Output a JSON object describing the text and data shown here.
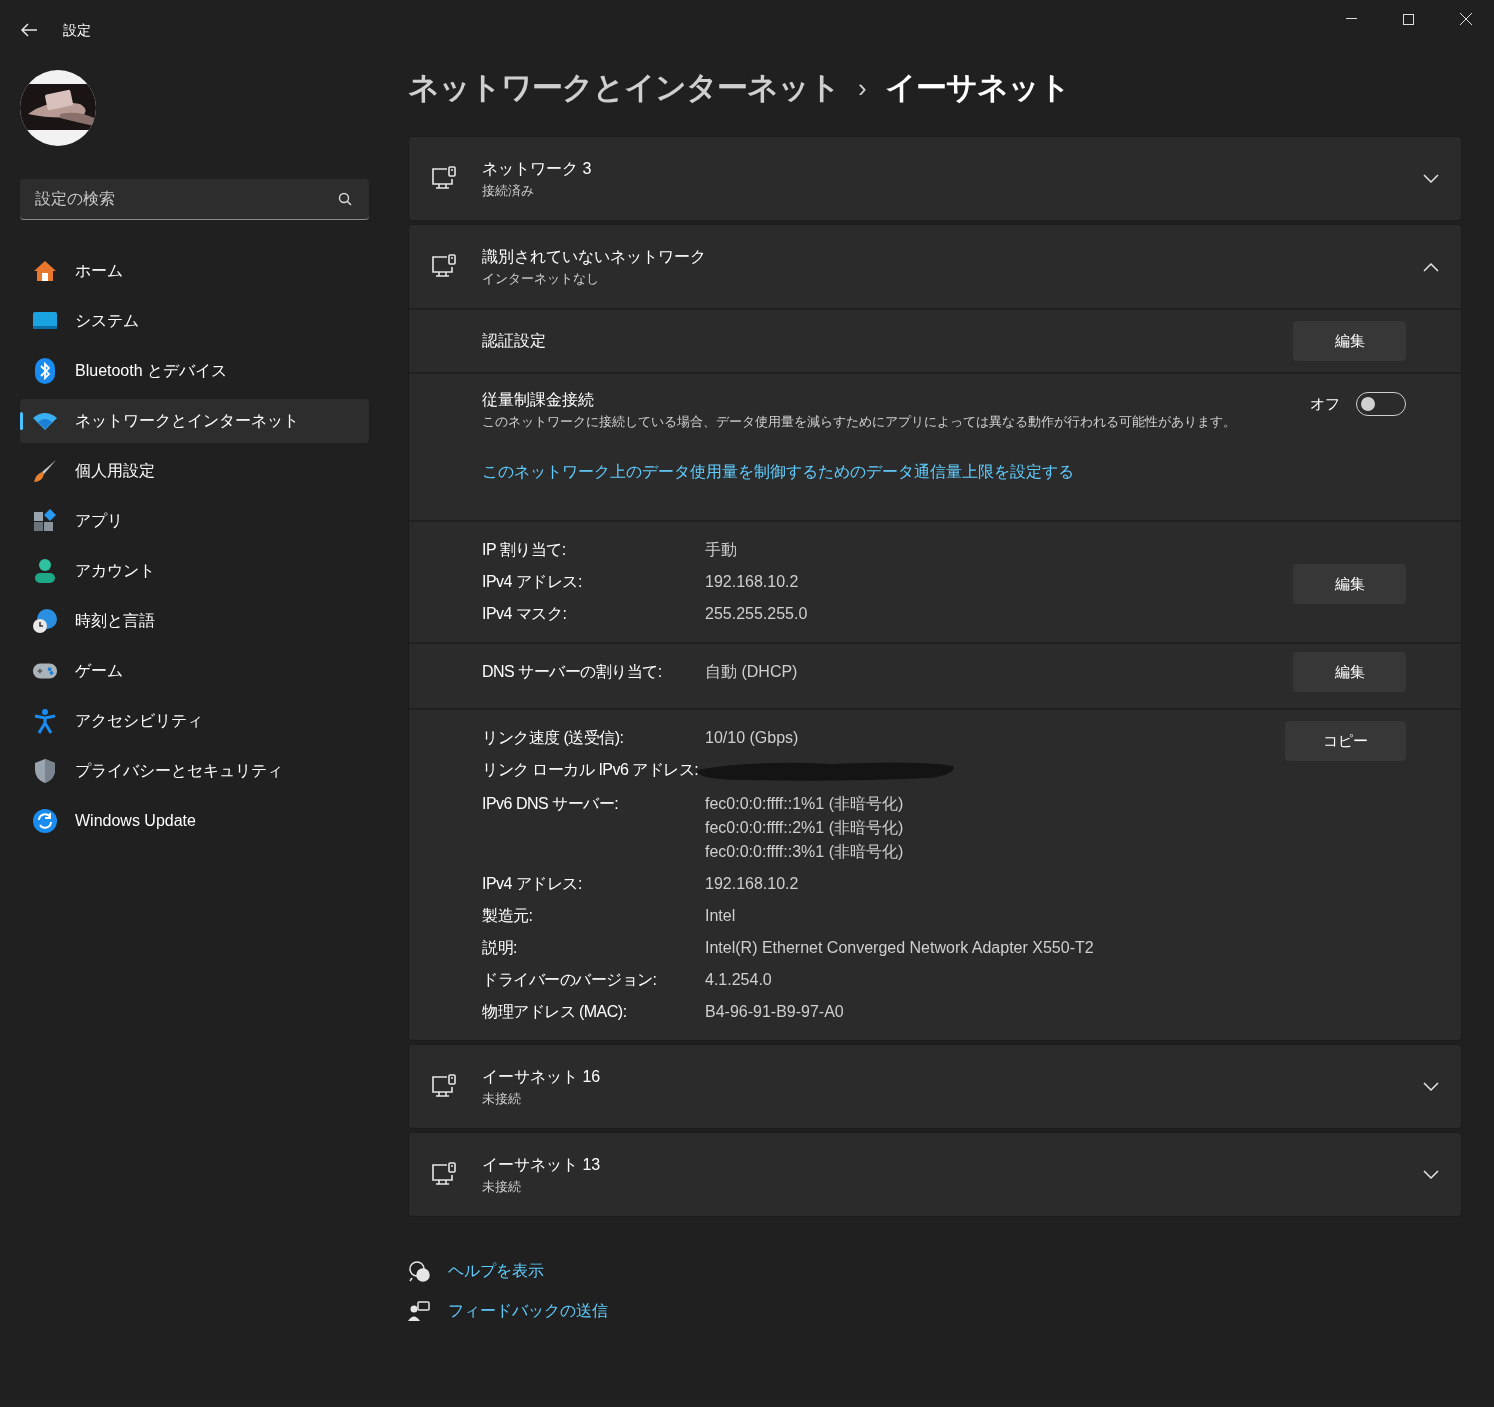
{
  "window": {
    "title": "設定"
  },
  "sidebar": {
    "search": {
      "placeholder": "設定の検索"
    },
    "items": [
      {
        "label": "ホーム",
        "selected": false
      },
      {
        "label": "システム",
        "selected": false
      },
      {
        "label": "Bluetooth とデバイス",
        "selected": false
      },
      {
        "label": "ネットワークとインターネット",
        "selected": true
      },
      {
        "label": "個人用設定",
        "selected": false
      },
      {
        "label": "アプリ",
        "selected": false
      },
      {
        "label": "アカウント",
        "selected": false
      },
      {
        "label": "時刻と言語",
        "selected": false
      },
      {
        "label": "ゲーム",
        "selected": false
      },
      {
        "label": "アクセシビリティ",
        "selected": false
      },
      {
        "label": "プライバシーとセキュリティ",
        "selected": false
      },
      {
        "label": "Windows Update",
        "selected": false
      }
    ]
  },
  "breadcrumb": {
    "parent": "ネットワークとインターネット",
    "separator": "›",
    "current": "イーサネット"
  },
  "networks": [
    {
      "name": "ネットワーク 3",
      "status": "接続済み",
      "expanded": false
    },
    {
      "name": "識別されていないネットワーク",
      "status": "インターネットなし",
      "expanded": true,
      "sections": [
        {
          "kind": "setting",
          "title": "認証設定",
          "button": "編集"
        },
        {
          "kind": "toggle",
          "title": "従量制課金接続",
          "description": "このネットワークに接続している場合、データ使用量を減らすためにアプリによっては異なる動作が行われる可能性があります。",
          "toggle_label": "オフ",
          "on": false,
          "link": "このネットワーク上のデータ使用量を制御するためのデータ通信量上限を設定する"
        },
        {
          "kind": "info",
          "button": "編集",
          "rows": [
            {
              "label": "IP 割り当て:",
              "values": [
                "手動"
              ],
              "redacted": false
            },
            {
              "label": "IPv4 アドレス:",
              "values": [
                "192.168.10.2"
              ],
              "redacted": false
            },
            {
              "label": "IPv4 マスク:",
              "values": [
                "255.255.255.0"
              ],
              "redacted": false
            }
          ]
        },
        {
          "kind": "info",
          "button": "編集",
          "rows": [
            {
              "label": "DNS サーバーの割り当て:",
              "values": [
                "自動 (DHCP)"
              ],
              "redacted": false
            }
          ]
        },
        {
          "kind": "info",
          "button": "コピー",
          "rows": [
            {
              "label": "リンク速度 (送受信):",
              "values": [
                "10/10 (Gbps)"
              ],
              "redacted": false
            },
            {
              "label": "リンク ローカル IPv6 アドレス:",
              "values": [],
              "redacted": true
            },
            {
              "label": "IPv6 DNS サーバー:",
              "values": [
                "fec0:0:0:ffff::1%1 (非暗号化)",
                "fec0:0:0:ffff::2%1 (非暗号化)",
                "fec0:0:0:ffff::3%1 (非暗号化)"
              ],
              "redacted": false
            },
            {
              "label": "IPv4 アドレス:",
              "values": [
                "192.168.10.2"
              ],
              "redacted": false
            },
            {
              "label": "製造元:",
              "values": [
                "Intel"
              ],
              "redacted": false
            },
            {
              "label": "説明:",
              "values": [
                "Intel(R) Ethernet Converged Network Adapter X550-T2"
              ],
              "redacted": false
            },
            {
              "label": "ドライバーのバージョン:",
              "values": [
                "4.1.254.0"
              ],
              "redacted": false
            },
            {
              "label": "物理アドレス (MAC):",
              "values": [
                "B4-96-91-B9-97-A0"
              ],
              "redacted": false
            }
          ]
        }
      ]
    },
    {
      "name": "イーサネット 16",
      "status": "未接続",
      "expanded": false
    },
    {
      "name": "イーサネット 13",
      "status": "未接続",
      "expanded": false
    }
  ],
  "footer_links": [
    "ヘルプを表示",
    "フィードバックの送信"
  ]
}
